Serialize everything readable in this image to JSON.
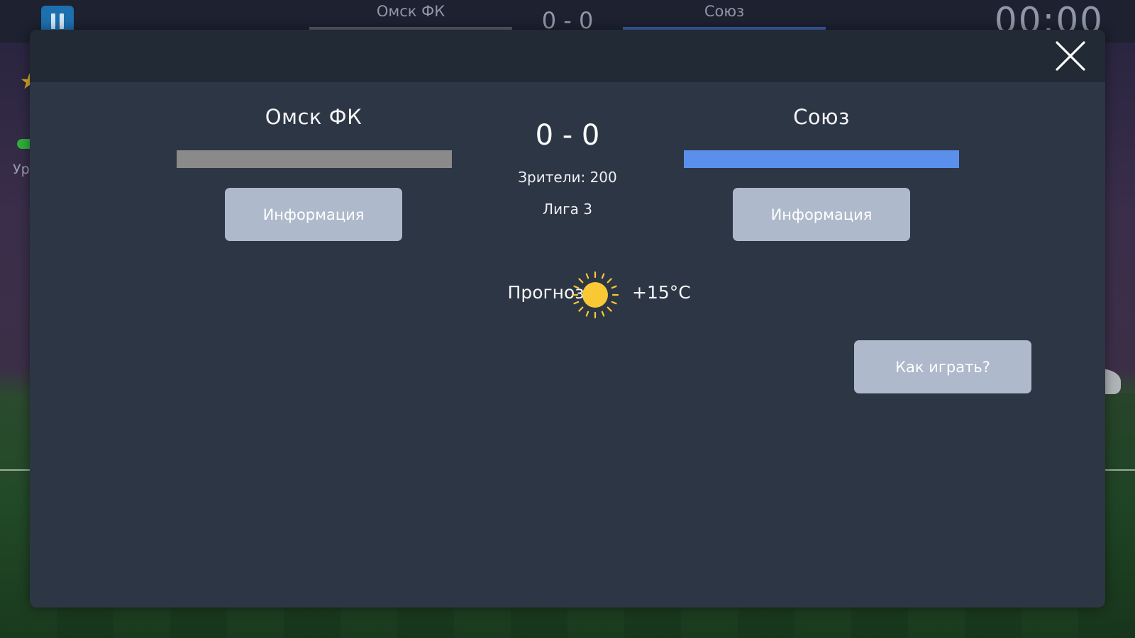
{
  "background": {
    "level_text": "Ур",
    "colors": {
      "scene": "#3a2e4a",
      "pitch": "#224a28"
    }
  },
  "hud": {
    "home_team": "Омск ФК",
    "away_team": "Союз",
    "score": "0 - 0",
    "timer": "00:00",
    "pause_icon": "pause-icon",
    "colors": {
      "home": "#555b68",
      "away": "#3a5fa6"
    }
  },
  "modal": {
    "close_icon": "close-icon",
    "home": {
      "name": "Омск ФК",
      "color": "#8a8a8a",
      "info_label": "Информация"
    },
    "away": {
      "name": "Союз",
      "color": "#5b8fec",
      "info_label": "Информация"
    },
    "score": "0 - 0",
    "spectators": "Зрители: 200",
    "league": "Лига 3",
    "forecast": {
      "label": "Прогноз:",
      "icon": "sun-icon",
      "temperature": "+15°C"
    },
    "how_to_play_label": "Как играть?",
    "colors": {
      "panel": "#2d3644",
      "header": "#222a35",
      "button": "#aeb9cb"
    }
  }
}
